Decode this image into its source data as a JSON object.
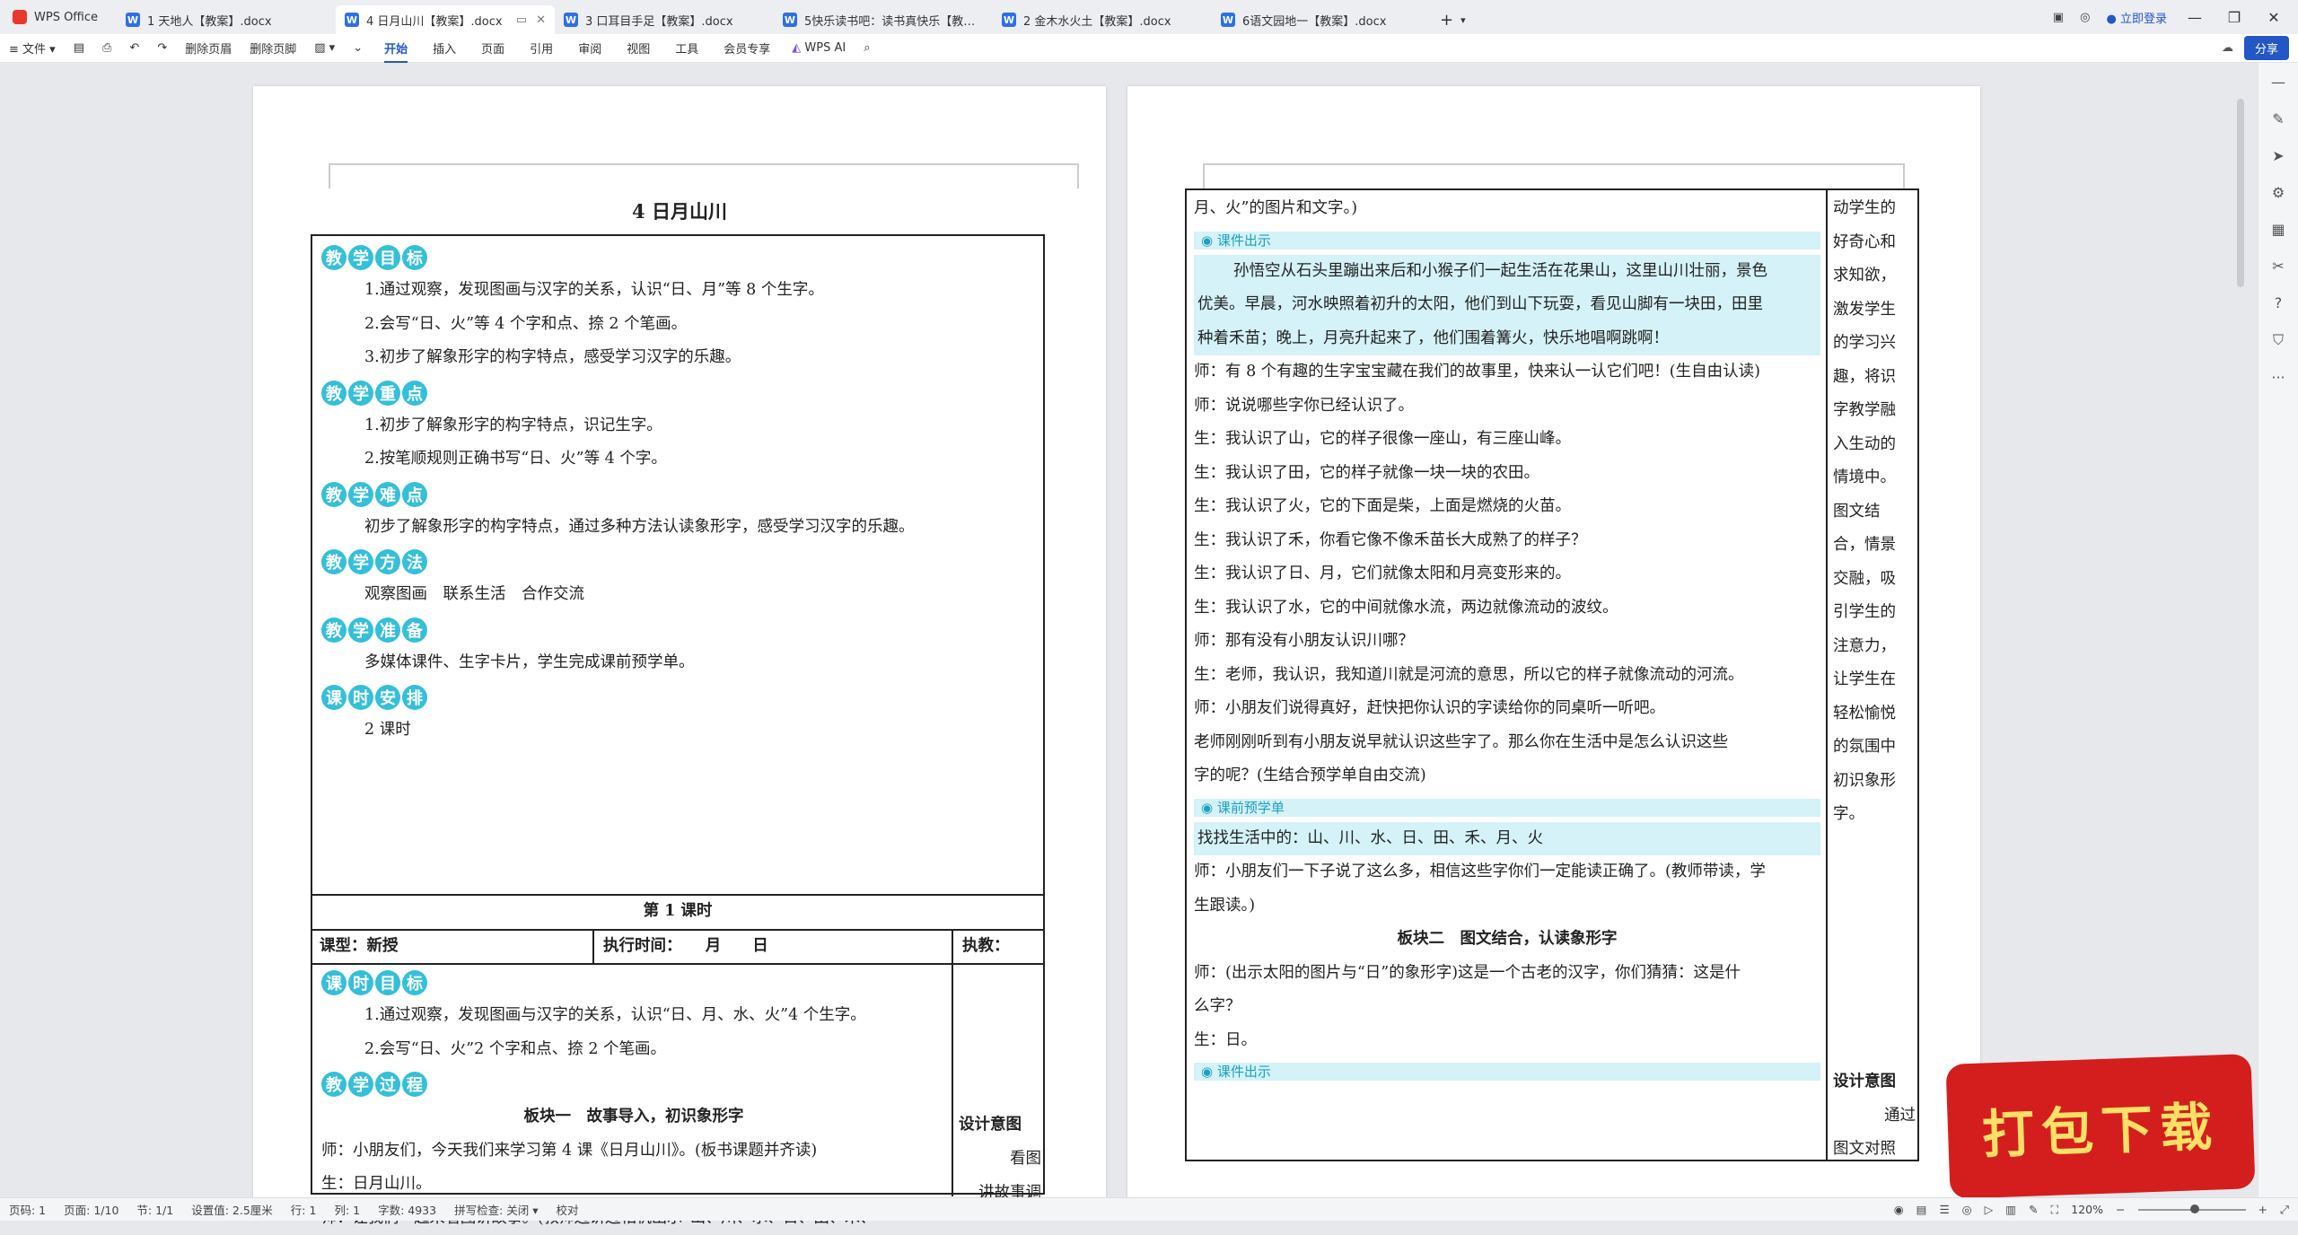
{
  "app": {
    "name": "WPS Office"
  },
  "tabs": [
    {
      "label": "1 天地人【教案】.docx"
    },
    {
      "label": "4 日月山川【教案】.docx",
      "active": true
    },
    {
      "label": "3 口耳目手足【教案】.docx"
    },
    {
      "label": "5快乐读书吧：读书真快乐【教案】.d..."
    },
    {
      "label": "2 金木水火土【教案】.docx"
    },
    {
      "label": "6语文园地一【教案】.docx"
    }
  ],
  "titlebar": {
    "login": "立即登录",
    "add": "+"
  },
  "ribbon": {
    "file": "文件",
    "del_header": "删除页眉",
    "del_footer": "删除页脚",
    "tabs": [
      "开始",
      "插入",
      "页面",
      "引用",
      "审阅",
      "视图",
      "工具",
      "会员专享"
    ],
    "ai": "WPS AI",
    "share": "分享"
  },
  "page1": {
    "title": "4  日月山川",
    "badges": {
      "goal": [
        "教",
        "学",
        "目",
        "标"
      ],
      "key": [
        "教",
        "学",
        "重",
        "点"
      ],
      "hard": [
        "教",
        "学",
        "难",
        "点"
      ],
      "method": [
        "教",
        "学",
        "方",
        "法"
      ],
      "prep": [
        "教",
        "学",
        "准",
        "备"
      ],
      "time": [
        "课",
        "时",
        "安",
        "排"
      ],
      "lesson_goal": [
        "课",
        "时",
        "目",
        "标"
      ],
      "process": [
        "教",
        "学",
        "过",
        "程"
      ]
    },
    "goals": [
      "1.通过观察，发现图画与汉字的关系，认识“日、月”等 8 个生字。",
      "2.会写“日、火”等 4 个字和点、捺 2 个笔画。",
      "3.初步了解象形字的构字特点，感受学习汉字的乐趣。"
    ],
    "key_points": [
      "1.初步了解象形字的构字特点，识记生字。",
      "2.按笔顺规则正确书写“日、火”等 4 个字。"
    ],
    "hard_point": "初步了解象形字的构字特点，通过多种方法认读象形字，感受学习汉字的乐趣。",
    "method": "观察图画　联系生活　合作交流",
    "prep": "多媒体课件、生字卡片，学生完成课前预学单。",
    "time": "2 课时",
    "lesson1": "第 1 课时",
    "type": "课型：新授",
    "exec_time": "执行时间：　　月　　日",
    "teacher": "执教：",
    "lesson_goals": [
      "1.通过观察，发现图画与汉字的关系，认识“日、月、水、火”4 个生字。",
      "2.会写“日、火”2 个字和点、捺 2 个笔画。"
    ],
    "block1": "板块一　故事导入，初识象形字",
    "lines": [
      "师：小朋友们，今天我们来学习第 4 课《日月山川》。(板书课题并齐读)",
      "生：日月山川。",
      "师：让我们一起来看图讲故事。(教师边讲边相机出示“山、川、水、日、田、禾、"
    ],
    "side_head": "设计意图",
    "side": [
      "看图",
      "讲故事调"
    ]
  },
  "page2": {
    "lines1": [
      "月、火”的图片和文字。)"
    ],
    "tag1": "课件出示",
    "story": [
      "孙悟空从石头里蹦出来后和小猴子们一起生活在花果山，这里山川壮丽，景色",
      "优美。早晨，河水映照着初升的太阳，他们到山下玩耍，看见山脚有一块田，田里",
      "种着禾苗；晚上，月亮升起来了，他们围着篝火，快乐地唱啊跳啊！"
    ],
    "dialog": [
      "师：有 8 个有趣的生字宝宝藏在我们的故事里，快来认一认它们吧！(生自由认读)",
      "师：说说哪些字你已经认识了。",
      "生：我认识了山，它的样子很像一座山，有三座山峰。",
      "生：我认识了田，它的样子就像一块一块的农田。",
      "生：我认识了火，它的下面是柴，上面是燃烧的火苗。",
      "生：我认识了禾，你看它像不像禾苗长大成熟了的样子？",
      "生：我认识了日、月，它们就像太阳和月亮变形来的。",
      "生：我认识了水，它的中间就像水流，两边就像流动的波纹。",
      "师：那有没有小朋友认识川哪？",
      "生：老师，我认识，我知道川就是河流的意思，所以它的样子就像流动的河流。",
      "师：小朋友们说得真好，赶快把你认识的字读给你的同桌听一听吧。",
      "老师刚刚听到有小朋友说早就认识这些字了。那么你在生活中是怎么认识这些",
      "字的呢？(生结合预学单自由交流)"
    ],
    "tag2": "课前预学单",
    "prelearn": "找找生活中的：山、川、水、日、田、禾、月、火",
    "dialog2": [
      "师：小朋友们一下子说了这么多，相信这些字你们一定能读正确了。(教师带读，学",
      "生跟读。)"
    ],
    "block2": "板块二　图文结合，认读象形字",
    "dialog3": [
      "师：(出示太阳的图片与“日”的象形字)这是一个古老的汉字，你们猜猜：这是什",
      "么字？",
      "生：日。"
    ],
    "tag3": "课件出示",
    "side": [
      "动学生的",
      "好奇心和",
      "求知欲，",
      "激发学生",
      "的学习兴",
      "趣，将识",
      "字教学融",
      "入生动的",
      "情境中。",
      "图文结",
      "合，情景",
      "交融，吸",
      "引学生的",
      "注意力，",
      "让学生在",
      "轻松愉悦",
      "的氛围中",
      "初识象形",
      "字。"
    ],
    "side_head": "设计意图",
    "side2": [
      "通过",
      "图文对照"
    ]
  },
  "status": {
    "page": "页码: 1",
    "pages": "页面: 1/10",
    "section": "节: 1/1",
    "setting": "设置值: 2.5厘米",
    "row": "行: 1",
    "col": "列: 1",
    "words": "字数: 4933",
    "spell": "拼写检查: 关闭",
    "proof": "校对",
    "zoom": "120%"
  },
  "watermark": "打包下载"
}
